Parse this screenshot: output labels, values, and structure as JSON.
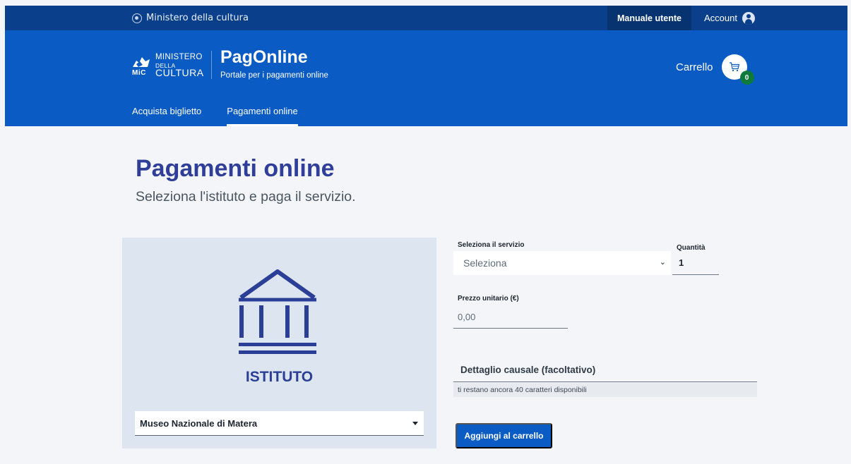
{
  "topbar": {
    "ministry_label": "Ministero della cultura",
    "manual_label": "Manuale utente",
    "account_label": "Account"
  },
  "header": {
    "logo": {
      "line1": "MINISTERO",
      "line2": "DELLA",
      "line3": "CULTURA",
      "mic": "MiC"
    },
    "app_title": "PagOnline",
    "app_subtitle": "Portale per i pagamenti online",
    "cart_label": "Carrello",
    "cart_count": "0",
    "nav": [
      {
        "label": "Acquista biglietto",
        "active": false
      },
      {
        "label": "Pagamenti online",
        "active": true
      }
    ]
  },
  "main": {
    "title": "Pagamenti online",
    "subtitle": "Seleziona l'istituto e paga il servizio.",
    "institute": {
      "label": "ISTITUTO",
      "selected": "Museo Nazionale di Matera"
    },
    "form": {
      "service_label": "Seleziona il servizio",
      "service_value": "Seleziona",
      "quantity_label": "Quantità",
      "quantity_value": "1",
      "price_label": "Prezzo unitario (€)",
      "price_value": "0,00",
      "causale_placeholder": "Dettaglio causale (facoltativo)",
      "causale_help": "ti restano ancora 40 caratteri disponibili",
      "add_button": "Aggiungi al carrello"
    }
  },
  "colors": {
    "topbar": "#0a3f8b",
    "header": "#0b5bc4",
    "title": "#2f3e99",
    "badge": "#0f7a3c",
    "card": "#dde6f0"
  }
}
